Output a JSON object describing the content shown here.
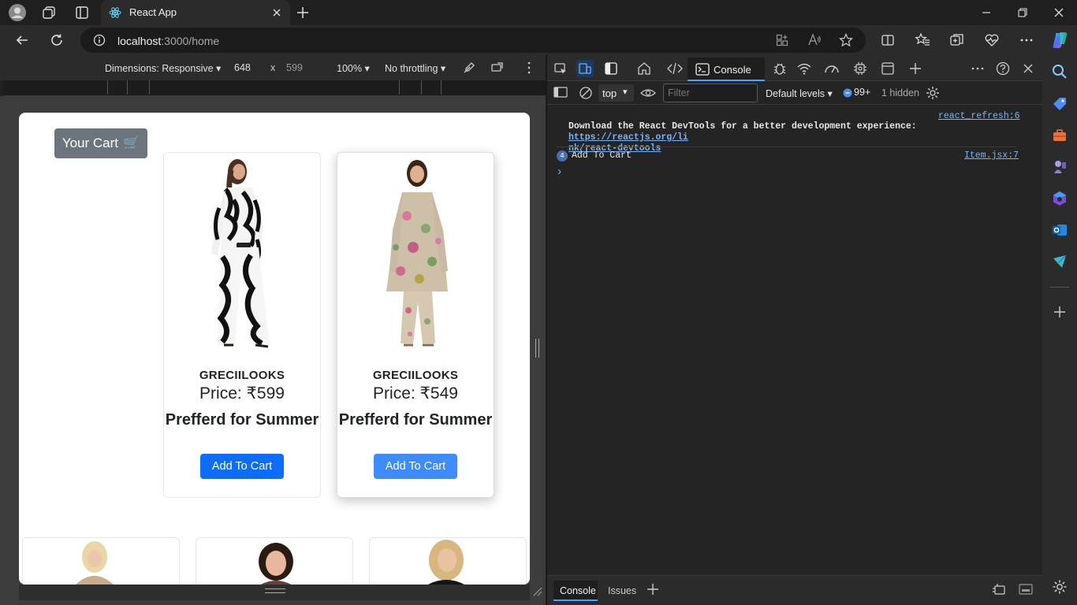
{
  "browser": {
    "tab_title": "React App",
    "url_host": "localhost",
    "url_path": ":3000/home"
  },
  "device_toolbar": {
    "dimensions_label": "Dimensions: Responsive",
    "width": "648",
    "separator": "x",
    "height": "599",
    "zoom": "100%",
    "throttling": "No throttling"
  },
  "app": {
    "cart_button": "Your Cart",
    "cart_emoji": "🛒",
    "products": [
      {
        "brand": "GRECIILOOKS",
        "price": "Price: ₹599",
        "desc": "Prefferd for Summer",
        "button": "Add To Cart"
      },
      {
        "brand": "GRECIILOOKS",
        "price": "Price: ₹549",
        "desc": "Prefferd for Summer",
        "button": "Add To Cart"
      }
    ]
  },
  "devtools": {
    "console_tab": "Console",
    "context": "top",
    "filter_placeholder": "Filter",
    "levels": "Default levels",
    "issues_count": "99+",
    "hidden": "1 hidden",
    "messages": [
      {
        "source": "react_refresh:6",
        "text": "Download the React DevTools for a better development experience: ",
        "link_a": "https://reactjs.org/li",
        "link_b": "nk/react-devtools"
      },
      {
        "count": "4",
        "text": "Add To Cart",
        "source": "Item.jsx:7"
      }
    ],
    "prompt": "›",
    "footer_tabs": [
      "Console",
      "Issues"
    ]
  }
}
